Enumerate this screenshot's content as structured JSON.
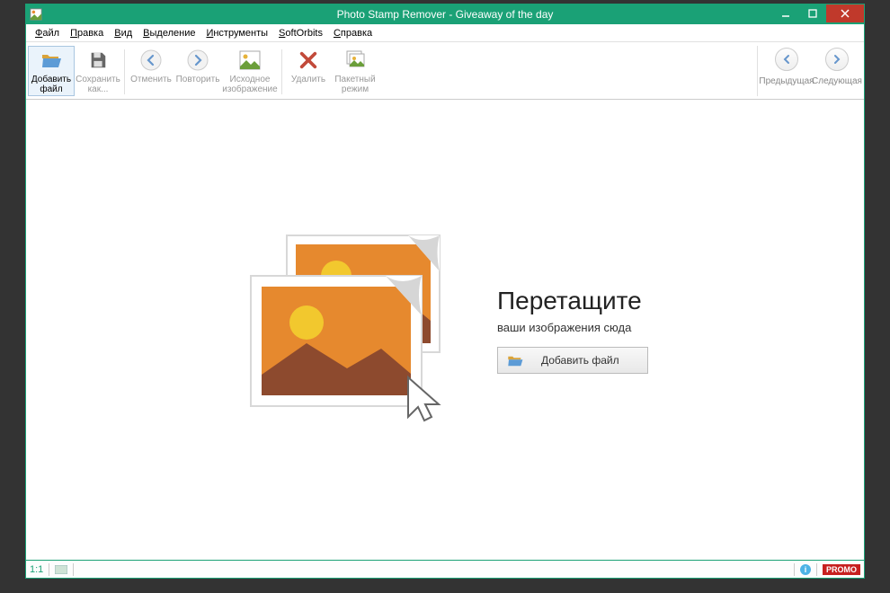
{
  "window": {
    "title": "Photo Stamp Remover - Giveaway of the day"
  },
  "menu": {
    "file": "Файл",
    "edit": "Правка",
    "view": "Вид",
    "selection": "Выделение",
    "tools": "Инструменты",
    "softorbits": "SoftOrbits",
    "help": "Справка"
  },
  "toolbar": {
    "add_file": "Добавить файл",
    "save_as": "Сохранить как...",
    "undo": "Отменить",
    "redo": "Повторить",
    "original_image": "Исходное изображение",
    "delete": "Удалить",
    "batch_mode": "Пакетный режим",
    "prev": "Предыдущая",
    "next": "Следующая"
  },
  "dropzone": {
    "heading": "Перетащите",
    "sub": "ваши изображения сюда",
    "button": "Добавить файл"
  },
  "status": {
    "zoom": "1:1",
    "promo": "PROMO"
  },
  "colors": {
    "accent": "#1aa176",
    "danger": "#c0392b"
  }
}
